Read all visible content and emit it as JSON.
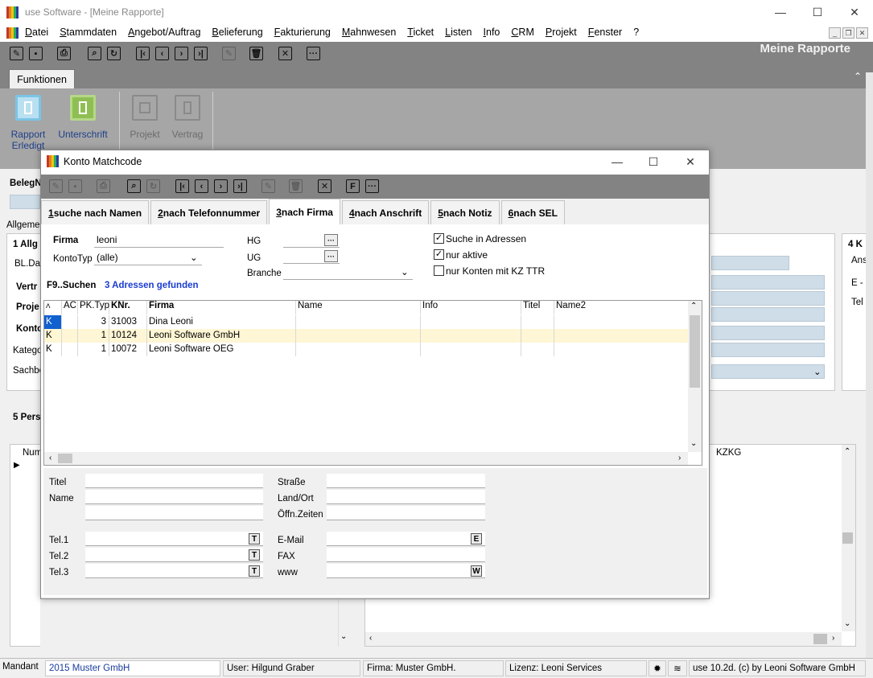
{
  "app": {
    "window_title": "use Software - [Meine Rapporte]",
    "page_heading": "Meine Rapporte",
    "menu": [
      "Datei",
      "Stammdaten",
      "Angebot/Auftrag",
      "Belieferung",
      "Fakturierung",
      "Mahnwesen",
      "Ticket",
      "Listen",
      "Info",
      "CRM",
      "Projekt",
      "Fenster",
      "?"
    ],
    "window_controls": {
      "minimize": "—",
      "maximize": "☐",
      "close": "✕"
    },
    "mdi_controls": {
      "minimize": "_",
      "restore": "❐",
      "close": "✕"
    }
  },
  "ribbon": {
    "tab": "Funktionen",
    "buttons": [
      {
        "label_line1": "Rapport",
        "label_line2": "Erledigt",
        "icon": "rapport-icon",
        "enabled": true
      },
      {
        "label_line1": "Unterschrift",
        "label_line2": "",
        "icon": "signature-icon",
        "enabled": true
      },
      {
        "label_line1": "Projekt",
        "label_line2": "",
        "icon": "project-icon",
        "enabled": false
      },
      {
        "label_line1": "Vertrag",
        "label_line2": "",
        "icon": "contract-icon",
        "enabled": false
      }
    ]
  },
  "background_form": {
    "belegnr_label": "BelegN",
    "allgemein_tab": "Allgemein",
    "section1_title": "1 Allg",
    "bl_datum": "BL.Dat",
    "vertrag": "Vertr",
    "projekt": "Proje",
    "konto": "Konto",
    "kategorie": "Katego",
    "sachbearbeiter": "Sachbe",
    "section4_title": "4 K",
    "ans": "Ans",
    "email_short": "E -",
    "tel_short": "Tel",
    "section5_title": "5 Pers",
    "num_col": "Num",
    "kzkg_col": "KZKG"
  },
  "dialog": {
    "title": "Konto Matchcode",
    "window_controls": {
      "minimize": "—",
      "maximize": "☐",
      "close": "✕"
    },
    "tabs": [
      {
        "key": "1",
        "label": " suche nach Namen",
        "active": false
      },
      {
        "key": "2",
        "label": " nach Telefonnummer",
        "active": false
      },
      {
        "key": "3",
        "label": " nach Firma",
        "active": true
      },
      {
        "key": "4",
        "label": " nach Anschrift",
        "active": false
      },
      {
        "key": "5",
        "label": " nach Notiz",
        "active": false
      },
      {
        "key": "6",
        "label": " nach SEL",
        "active": false
      }
    ],
    "filters": {
      "firma_label": "Firma",
      "firma_value": "leoni",
      "kontotyp_label": "KontoTyp",
      "kontotyp_value": "(alle)",
      "hg_label": "HG",
      "ug_label": "UG",
      "branche_label": "Branche",
      "suche_in_adressen": "Suche in Adressen",
      "nur_aktive": "nur aktive",
      "nur_konten_kz_ttr": "nur Konten mit KZ TTR",
      "suche_in_adressen_checked": true,
      "nur_aktive_checked": true,
      "nur_konten_kz_ttr_checked": false
    },
    "search_hint": "F9..Suchen",
    "result_count": "3 Adressen gefunden",
    "grid": {
      "columns": [
        "A",
        "AC",
        "PK.Typ",
        "KNr.",
        "Firma",
        "Name",
        "Info",
        "Titel",
        "Name2"
      ],
      "rows": [
        {
          "a": "K",
          "ac": "",
          "pktyp": "3",
          "knr": "31003",
          "firma": "Dina Leoni",
          "name": "",
          "info": "",
          "titel": "",
          "name2": ""
        },
        {
          "a": "K",
          "ac": "",
          "pktyp": "1",
          "knr": "10124",
          "firma": "Leoni Software GmbH",
          "name": "",
          "info": "",
          "titel": "",
          "name2": ""
        },
        {
          "a": "K",
          "ac": "",
          "pktyp": "1",
          "knr": "10072",
          "firma": "Leoni Software OEG",
          "name": "",
          "info": "",
          "titel": "",
          "name2": ""
        }
      ]
    },
    "detail": {
      "titel": "Titel",
      "name": "Name",
      "tel1": "Tel.1",
      "tel2": "Tel.2",
      "tel3": "Tel.3",
      "strasse": "Straße",
      "land_ort": "Land/Ort",
      "oeffn_zeiten": "Öffn.Zeiten",
      "email": "E-Mail",
      "fax": "FAX",
      "www": "www",
      "t_btn": "T",
      "e_btn": "E",
      "w_btn": "W"
    }
  },
  "statusbar": {
    "mandant_label": "Mandant",
    "mandant_value": "2015 Muster GmbH",
    "user": "User: Hilgund Graber",
    "firma": "Firma: Muster GmbH.",
    "lizenz": "Lizenz: Leoni Services",
    "version": "use 10.2d. (c) by Leoni Software GmbH"
  }
}
